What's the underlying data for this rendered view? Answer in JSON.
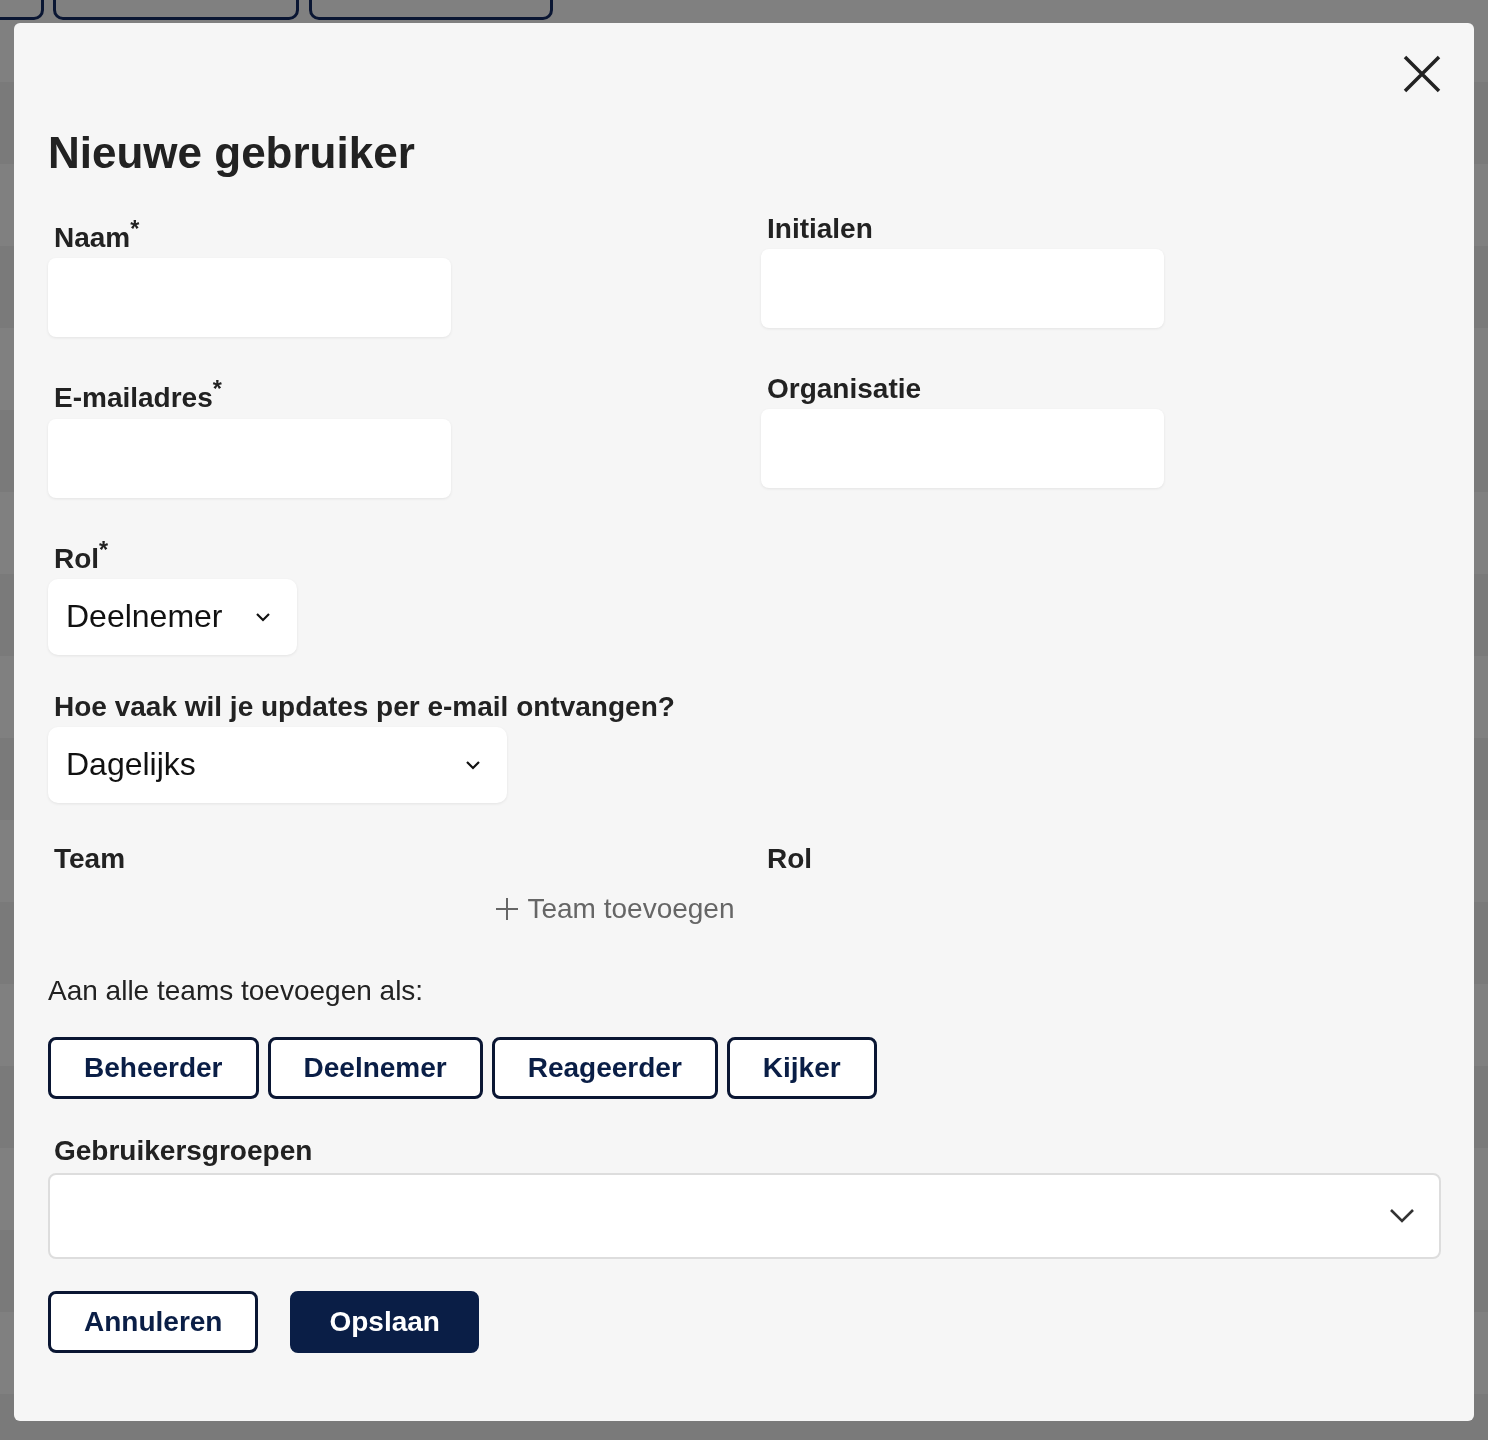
{
  "dialog": {
    "title": "Nieuwe gebruiker",
    "fields": [
      {
        "label": "Naam$^{*}$",
        "kind": "text"
      },
      {
        "label": "Initialen",
        "kind": "text"
      },
      {
        "label": "E-mailadres$^{*}$",
        "kind": "text"
      },
      {
        "label": "Organisatie",
        "kind": "text"
      }
    ],
    "role": {
      "label": "Rol$^{*}$",
      "value": "Deelnemer"
    },
    "frequency": {
      "label": "Hoe vaak wil je updates per e-mail ontvangen?",
      "value": "Dagelijks"
    },
    "team_table": {
      "columns": [
        "Team",
        "Rol"
      ],
      "add_button": "Team toevoegen"
    },
    "bulk_label": "Aan alle teams toevoegen als:",
    "bulk_roles": [
      "Beheerder",
      "Deelnemer",
      "Reageerder",
      "Kijker"
    ],
    "groups": {
      "label": "Gebruikersgroepen"
    },
    "buttons": [
      {
        "label": "Annuleren",
        "kind": "secondary"
      },
      {
        "label": "Opslaan",
        "kind": "primary"
      }
    ]
  }
}
